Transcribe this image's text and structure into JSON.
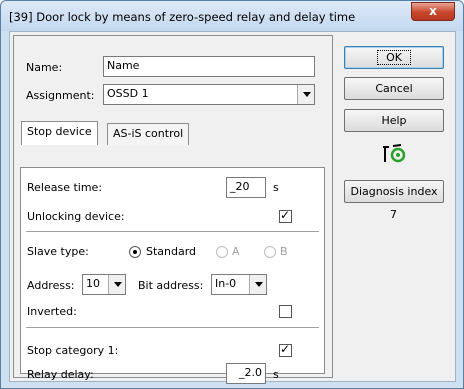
{
  "window": {
    "title": "[39] Door lock by means of zero-speed relay and delay time",
    "close_glyph": "x"
  },
  "form": {
    "name_label": "Name:",
    "name_value": "Name",
    "assignment_label": "Assignment:",
    "assignment_value": "OSSD 1"
  },
  "tabs": [
    {
      "label": "Stop device"
    },
    {
      "label": "AS-iS control"
    }
  ],
  "stop_device": {
    "release_time_label": "Release time:",
    "release_time_value": "20",
    "release_time_unit": "s",
    "unlocking_label": "Unlocking device:",
    "unlocking_checked": true,
    "slave_type_label": "Slave type:",
    "slave_options": [
      "Standard",
      "A",
      "B"
    ],
    "slave_selected": "Standard",
    "address_label": "Address:",
    "address_value": "10",
    "bit_address_label": "Bit address:",
    "bit_address_value": "In-0",
    "inverted_label": "Inverted:",
    "inverted_checked": false,
    "stop_category_label": "Stop category 1:",
    "stop_category_checked": true,
    "relay_delay_label": "Relay delay:",
    "relay_delay_value": "2.0",
    "relay_delay_unit": "s"
  },
  "buttons": {
    "ok": "OK",
    "cancel": "Cancel",
    "help": "Help",
    "diagnosis": "Diagnosis index",
    "diagnosis_value": "7"
  },
  "icons": {
    "status_icon": "zero-speed-relay-icon"
  },
  "colors": {
    "titlebar": "#c9dcf2",
    "close": "#c7452c",
    "icon_green": "#2aa12a"
  }
}
